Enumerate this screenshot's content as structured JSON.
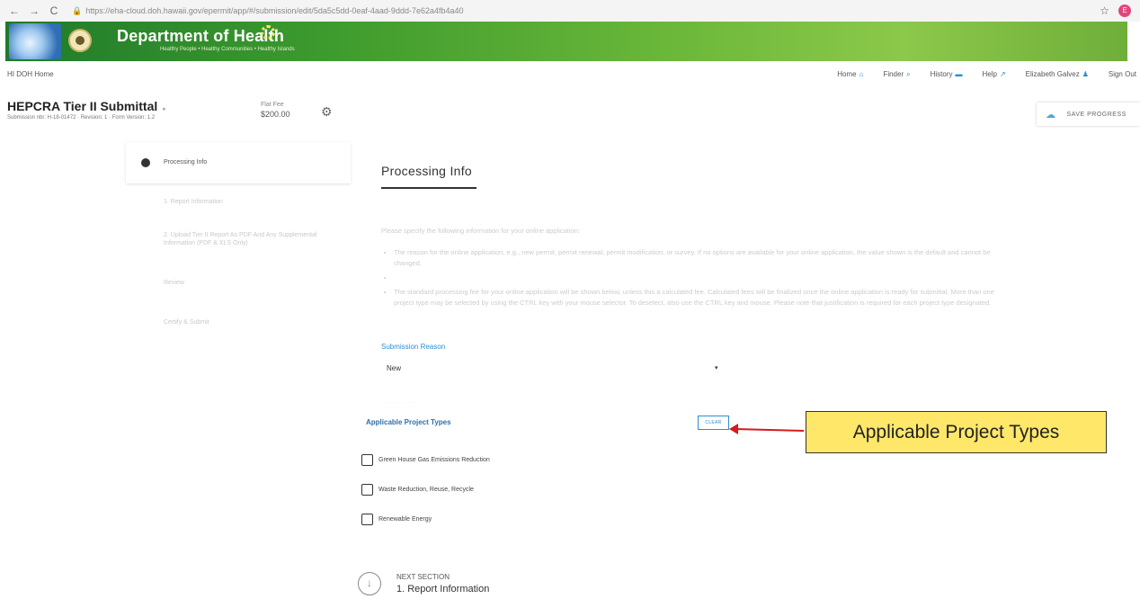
{
  "browser": {
    "back": "←",
    "forward": "→",
    "reload": "C",
    "lock": "🔒",
    "url": "https://eha-cloud.doh.hawaii.gov/epermit/app/#/submission/edit/5da5c5dd-0eaf-4aad-9ddd-7e62a4fb4a40",
    "star": "☆",
    "profile": "E"
  },
  "banner": {
    "title": "Department of Health",
    "tagline": "Healthy People • Healthy Communities • Healthy Islands"
  },
  "topnav": {
    "home_link": "HI DOH Home",
    "items": [
      {
        "label": "Home",
        "icon": "⌂"
      },
      {
        "label": "Finder",
        "icon": "⌕"
      },
      {
        "label": "History",
        "icon": "▬"
      },
      {
        "label": "Help",
        "icon": "↗"
      },
      {
        "label": "Elizabeth Galvez",
        "icon": "♟"
      },
      {
        "label": "Sign Out",
        "icon": ""
      }
    ]
  },
  "form": {
    "title": "HEPCRA Tier II Submittal",
    "title_caret": "▸",
    "meta": "Submission nbr: H-18-01472  ·  Revision: 1  ·  Form Version: 1.2",
    "fee_label": "Flat Fee",
    "fee_value": "$200.00",
    "gear": "⚙",
    "save_label": "SAVE PROGRESS",
    "save_icon": "☁"
  },
  "sidebar": {
    "steps": [
      "Processing Info",
      "1. Report Information",
      "2. Upload Tier II Report As PDF And Any Supplemental Information (PDF & XLS Only)",
      "Review",
      "Certify & Submit"
    ]
  },
  "main": {
    "heading": "Processing Info",
    "intro": "Please specify the following information for your online application:",
    "bullets": [
      "The reason for the online application, e.g., new permit, permit renewal, permit modification, or survey. If no options are available for your online application, the value shown is the default and cannot be changed.",
      "",
      "The standard processing fee for your online application will be shown below, unless this a calculated fee. Calculated fees will be finalized once the online application is ready for submittal. More than one project type may be selected by using the CTRL key with your mouse selector. To deselect, also use the CTRL key and mouse. Please note that justification is required for each project type designated."
    ],
    "submission_reason_label": "Submission Reason",
    "submission_reason_value": "New",
    "select_arrow": "▾",
    "faint_text": "· · · · · ·  · · · · · ·",
    "project_types_label": "Applicable Project Types",
    "clear_label": "CLEAR",
    "checkboxes": [
      "Green House Gas Emissions Reduction",
      "Waste Reduction, Reuse, Recycle",
      "Renewable Energy"
    ],
    "next_icon": "↓",
    "next_kicker": "NEXT SECTION",
    "next_title": "1. Report Information"
  },
  "annotation": {
    "callout": "Applicable Project Types",
    "arrow_color": "#d61b1b",
    "callout_color": "#ffe76a"
  }
}
